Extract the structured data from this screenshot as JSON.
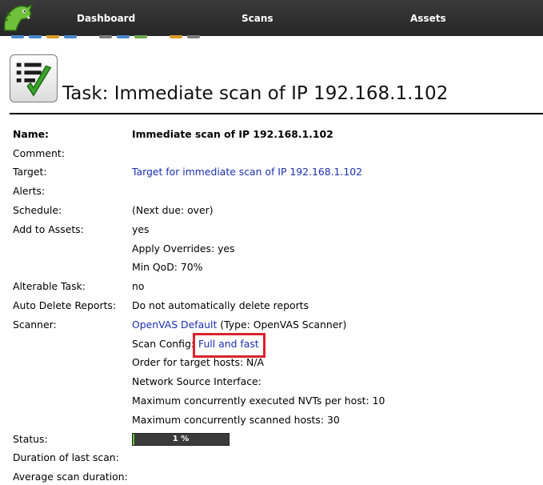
{
  "nav": {
    "dashboard": "Dashboard",
    "scans": "Scans",
    "assets": "Assets"
  },
  "page": {
    "title": "Task: Immediate scan of IP 192.168.1.102"
  },
  "details": {
    "name": {
      "label": "Name:",
      "value": "Immediate scan of IP 192.168.1.102"
    },
    "comment": {
      "label": "Comment:"
    },
    "target": {
      "label": "Target:",
      "value": "Target for immediate scan of IP 192.168.1.102"
    },
    "alerts": {
      "label": "Alerts:"
    },
    "schedule": {
      "label": "Schedule:",
      "value": "(Next due: over)"
    },
    "add_to_assets": {
      "label": "Add to Assets:",
      "value": "yes",
      "apply_overrides": "Apply Overrides: yes",
      "min_qod": "Min QoD: 70%"
    },
    "alterable": {
      "label": "Alterable Task:",
      "value": "no"
    },
    "auto_delete": {
      "label": "Auto Delete Reports:",
      "value": "Do not automatically delete reports"
    },
    "scanner": {
      "label": "Scanner:",
      "name": "OpenVAS Default",
      "type": " (Type: OpenVAS Scanner)",
      "scan_config_label": "Scan Config:",
      "scan_config_value": "Full and fast",
      "order": "Order for target hosts: N/A",
      "network_source": "Network Source Interface:",
      "max_nvts": "Maximum concurrently executed NVTs per host: 10",
      "max_hosts": "Maximum concurrently scanned hosts: 30"
    },
    "status": {
      "label": "Status:",
      "progress_text": "1 %",
      "progress_fraction": 0.01
    },
    "duration_last": {
      "label": "Duration of last scan:"
    },
    "average_duration": {
      "label": "Average scan duration:"
    }
  },
  "colors": {
    "nav_bg": "#2f2f2f",
    "link": "#1a2fb0",
    "highlight": "#d9232e",
    "progress_fill": "#5cc83a",
    "progress_bg": "#3b3b3b"
  },
  "icons": {
    "logo": "greenbone-dragon-logo-icon",
    "task": "task-checklist-icon"
  }
}
